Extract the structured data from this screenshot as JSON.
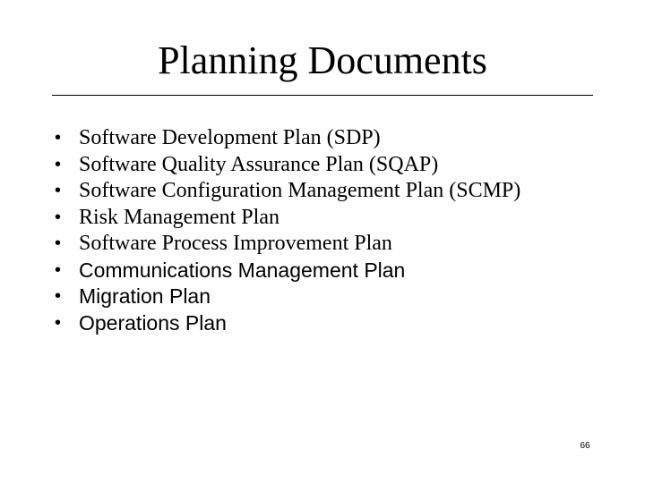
{
  "slide": {
    "title": "Planning Documents",
    "bullet_glyph": "•",
    "bullets": [
      {
        "text": "Software Development Plan (SDP)",
        "style": "serif"
      },
      {
        "text": "Software Quality Assurance Plan (SQAP)",
        "style": "serif"
      },
      {
        "text": "Software Configuration Management Plan (SCMP)",
        "style": "serif"
      },
      {
        "text": "Risk Management Plan",
        "style": "serif"
      },
      {
        "text": "Software Process Improvement Plan",
        "style": "serif"
      },
      {
        "text": "Communications Management Plan",
        "style": "sans"
      },
      {
        "text": "Migration Plan",
        "style": "sans"
      },
      {
        "text": "Operations Plan",
        "style": "sans"
      }
    ],
    "page_number": "66"
  }
}
